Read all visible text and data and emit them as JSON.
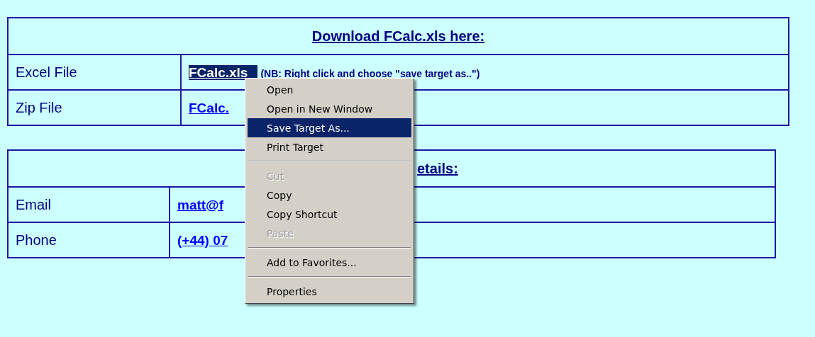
{
  "download_table": {
    "title": "Download FCalc.xls here:",
    "rows": [
      {
        "label": "Excel File",
        "link": "FCalc.xls",
        "selected": true,
        "note": "(NB: Right click and choose \"save target as..\")"
      },
      {
        "label": "Zip File",
        "link": "FCalc.",
        "selected": false
      }
    ]
  },
  "contact_table": {
    "title": "etails:",
    "rows": [
      {
        "label": "Email",
        "link": "matt@f"
      },
      {
        "label": "Phone",
        "link": "(+44) 07"
      }
    ]
  },
  "context_menu": {
    "items": [
      {
        "kind": "item",
        "label": "Open",
        "selected": false,
        "disabled": false
      },
      {
        "kind": "item",
        "label": "Open in New Window",
        "selected": false,
        "disabled": false
      },
      {
        "kind": "item",
        "label": "Save Target As...",
        "selected": true,
        "disabled": false
      },
      {
        "kind": "item",
        "label": "Print Target",
        "selected": false,
        "disabled": false
      },
      {
        "kind": "separator"
      },
      {
        "kind": "item",
        "label": "Cut",
        "selected": false,
        "disabled": true
      },
      {
        "kind": "item",
        "label": "Copy",
        "selected": false,
        "disabled": false
      },
      {
        "kind": "item",
        "label": "Copy Shortcut",
        "selected": false,
        "disabled": false
      },
      {
        "kind": "item",
        "label": "Paste",
        "selected": false,
        "disabled": true
      },
      {
        "kind": "separator"
      },
      {
        "kind": "item",
        "label": "Add to Favorites...",
        "selected": false,
        "disabled": false
      },
      {
        "kind": "separator"
      },
      {
        "kind": "item",
        "label": "Properties",
        "selected": false,
        "disabled": false
      }
    ]
  }
}
